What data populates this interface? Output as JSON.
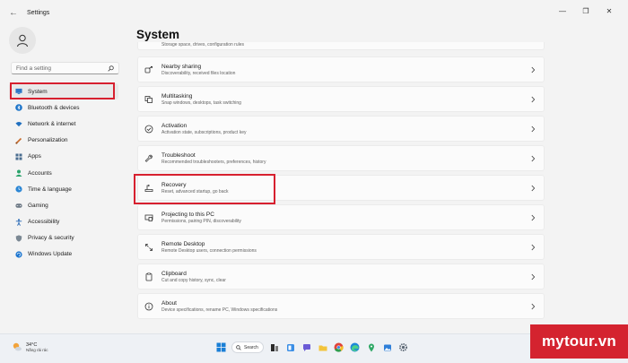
{
  "window": {
    "title": "Settings",
    "back_glyph": "←",
    "controls": [
      "—",
      "❐",
      "✕"
    ]
  },
  "search": {
    "placeholder": "Find a setting"
  },
  "nav": {
    "items": [
      {
        "label": "System",
        "icon": "monitor-icon"
      },
      {
        "label": "Bluetooth & devices",
        "icon": "bluetooth-icon"
      },
      {
        "label": "Network & internet",
        "icon": "wifi-icon"
      },
      {
        "label": "Personalization",
        "icon": "brush-icon"
      },
      {
        "label": "Apps",
        "icon": "apps-icon"
      },
      {
        "label": "Accounts",
        "icon": "accounts-icon"
      },
      {
        "label": "Time & language",
        "icon": "globe-clock-icon"
      },
      {
        "label": "Gaming",
        "icon": "gamepad-icon"
      },
      {
        "label": "Accessibility",
        "icon": "accessibility-icon"
      },
      {
        "label": "Privacy & security",
        "icon": "shield-icon"
      },
      {
        "label": "Windows Update",
        "icon": "update-icon"
      }
    ]
  },
  "main": {
    "title": "System",
    "partial_subtitle": "Storage space, drives, configuration rules",
    "cards": [
      {
        "title": "Nearby sharing",
        "subtitle": "Discoverability, received files location",
        "icon": "nearby-sharing-icon"
      },
      {
        "title": "Multitasking",
        "subtitle": "Snap windows, desktops, task switching",
        "icon": "multitasking-icon"
      },
      {
        "title": "Activation",
        "subtitle": "Activation state, subscriptions, product key",
        "icon": "activation-check-icon"
      },
      {
        "title": "Troubleshoot",
        "subtitle": "Recommended troubleshooters, preferences, history",
        "icon": "wrench-icon"
      },
      {
        "title": "Recovery",
        "subtitle": "Reset, advanced startup, go back",
        "icon": "recovery-drive-icon"
      },
      {
        "title": "Projecting to this PC",
        "subtitle": "Permissions, pairing PIN, discoverability",
        "icon": "projector-icon"
      },
      {
        "title": "Remote Desktop",
        "subtitle": "Remote Desktop users, connection permissions",
        "icon": "remote-desktop-icon"
      },
      {
        "title": "Clipboard",
        "subtitle": "Cut and copy history, sync, clear",
        "icon": "clipboard-icon"
      },
      {
        "title": "About",
        "subtitle": "Device specifications, rename PC, Windows specifications",
        "icon": "info-icon"
      }
    ]
  },
  "taskbar": {
    "weather": {
      "temp": "34°C",
      "condition": "Nắng rải rác"
    },
    "search_label": "Search"
  },
  "brand": {
    "text": "mytour.vn",
    "color": "#d4232f"
  },
  "colors": {
    "highlight_red": "#d7202f",
    "accent_blue": "#0067c0"
  }
}
